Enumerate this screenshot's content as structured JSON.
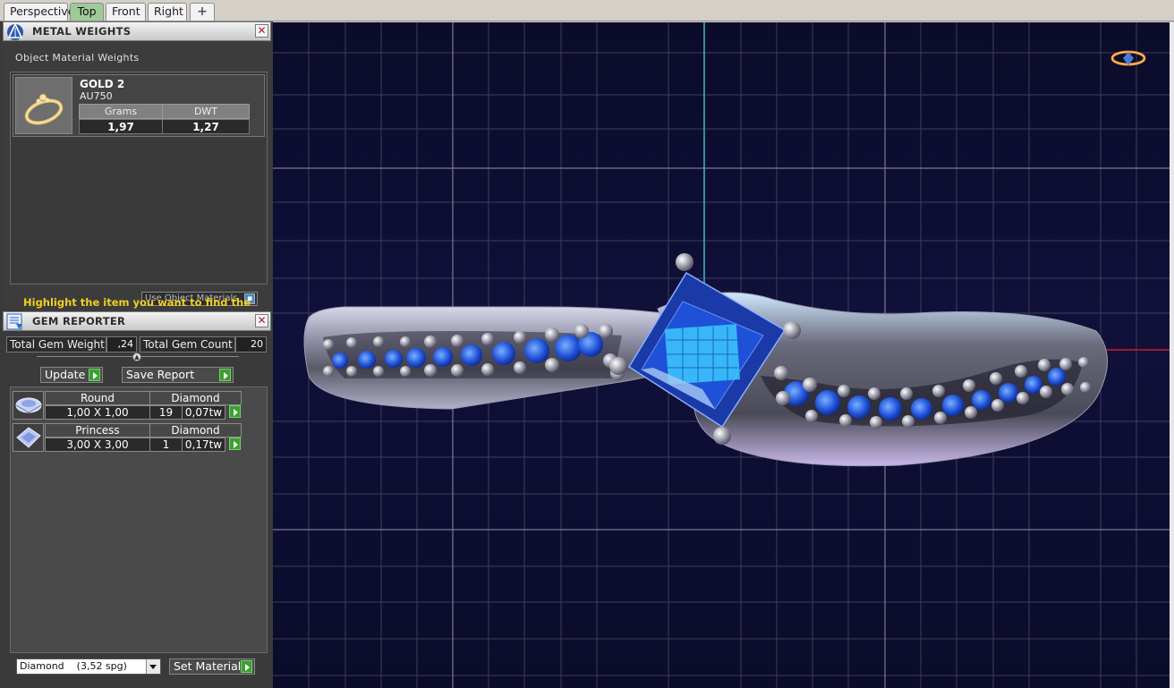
{
  "tabs": [
    {
      "label": "Perspective",
      "active": false
    },
    {
      "label": "Top",
      "active": true
    },
    {
      "label": "Front",
      "active": false
    },
    {
      "label": "Right",
      "active": false
    }
  ],
  "add_tab_icon": "plus-icon",
  "metal_weights": {
    "title": "METAL WEIGHTS",
    "subtitle": "Object Material Weights",
    "material": {
      "name": "GOLD 2",
      "alloy": "AU750",
      "grams_label": "Grams",
      "dwt_label": "DWT",
      "grams": "1,97",
      "dwt": "1,27"
    },
    "use_object_materials": "Use Object Materials",
    "use_object_materials_checked": true,
    "hint": "Highlight the item you want to find the weight"
  },
  "gem_reporter": {
    "title": "GEM REPORTER",
    "total_weight_label": "Total Gem Weight",
    "total_weight": ",24",
    "total_count_label": "Total Gem Count",
    "total_count": "20",
    "update_label": "Update",
    "save_report_label": "Save Report",
    "gems": [
      {
        "shape": "Round",
        "size": "1,00 X 1,00",
        "material": "Diamond",
        "count": "19",
        "weight": "0,07tw"
      },
      {
        "shape": "Princess",
        "size": "3,00 X 3,00",
        "material": "Diamond",
        "count": "1",
        "weight": "0,17tw"
      }
    ],
    "material_select": "Diamond    (3,52 spg)",
    "set_material_label": "Set Material"
  },
  "colors": {
    "viewport_bg": "#0b0b2a",
    "grid": "#6a6a7a",
    "gem_blue": "#1e50d8",
    "active_tab": "#9fca98",
    "hint_yellow": "#f0d020",
    "go_green": "#3aa030"
  }
}
